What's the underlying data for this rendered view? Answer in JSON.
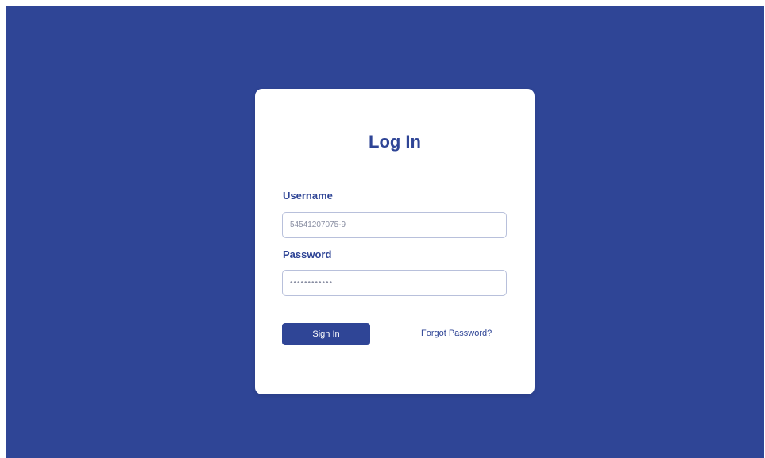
{
  "login": {
    "title": "Log In",
    "username_label": "Username",
    "username_value": "54541207075-9",
    "password_label": "Password",
    "password_value": "••••••••••••",
    "signin_label": "Sign In",
    "forgot_label": "Forgot Password?"
  },
  "colors": {
    "background": "#2f4596",
    "card": "#ffffff",
    "accent": "#2f4596",
    "input_border": "#b8c0db"
  }
}
